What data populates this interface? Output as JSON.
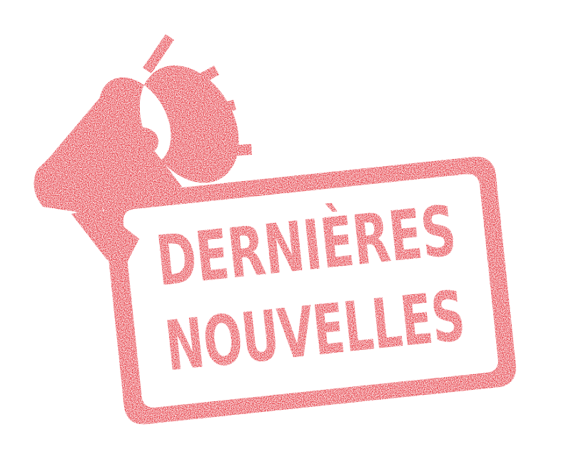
{
  "stamp": {
    "line1": "DERNIÈRES",
    "line2": "NOUVELLES"
  },
  "icon": "megaphone-icon",
  "colors": {
    "accent": "#e0141e",
    "background": "#ffffff"
  }
}
